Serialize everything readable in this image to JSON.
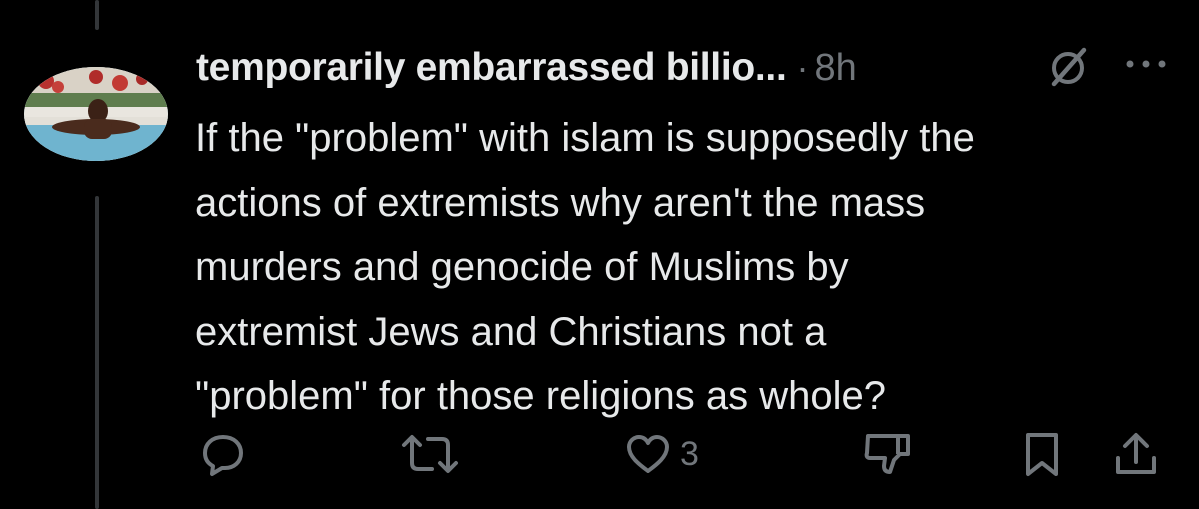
{
  "tweet": {
    "author_name": "temporarily embarrassed billio...",
    "separator": "·",
    "timestamp": "8h",
    "text_lines": [
      "If the \"problem\" with islam is supposedly the",
      "actions of extremists why aren't the mass",
      "murders and genocide of Muslims by",
      "extremist Jews and Christians not a",
      "\"problem\" for those religions as whole?"
    ],
    "likes_count": "3"
  },
  "icons": {
    "grok": "grok-slash-icon",
    "more": "more-dots-icon",
    "reply": "reply-bubble-icon",
    "retweet": "retweet-icon",
    "like": "heart-icon",
    "downvote": "downvote-icon",
    "bookmark": "bookmark-icon",
    "share": "share-icon"
  },
  "colors": {
    "background": "#000000",
    "text_primary": "#e7e9ea",
    "text_secondary": "#71767b",
    "thread_line": "#333639"
  }
}
